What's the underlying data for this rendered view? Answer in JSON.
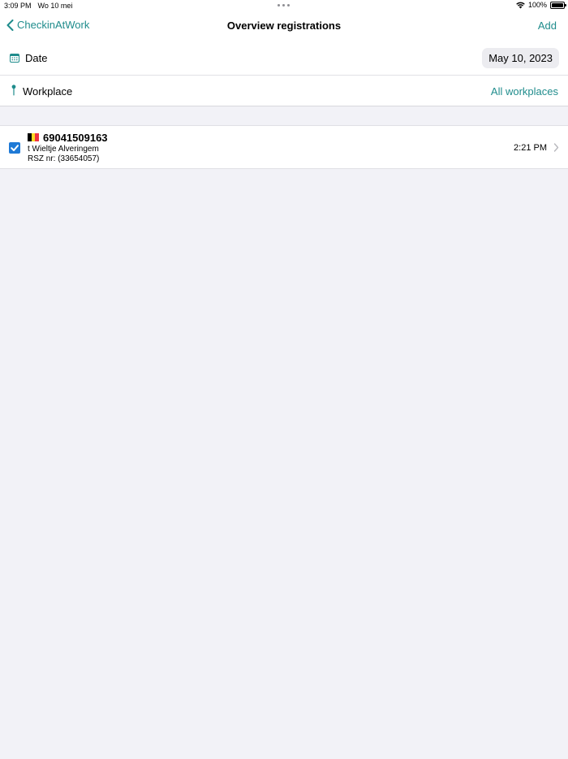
{
  "status_bar": {
    "time": "3:09 PM",
    "date": "Wo 10 mei",
    "battery": "100%",
    "icons": [
      "wifi-icon",
      "battery-icon"
    ]
  },
  "nav": {
    "back_label": "CheckinAtWork",
    "title": "Overview registrations",
    "add_label": "Add"
  },
  "filters": {
    "date_label": "Date",
    "date_value": "May 10, 2023",
    "workplace_label": "Workplace",
    "workplace_value": "All workplaces"
  },
  "registrations": [
    {
      "number": "69041509163",
      "place": "t Wieltje Alveringem",
      "rsz": "RSZ nr: (33654057)",
      "time": "2:21 PM",
      "checked": true,
      "flag": "belgium-flag-icon"
    }
  ],
  "colors": {
    "accent": "#1f8c8c",
    "checkbox": "#1f7ad6",
    "background": "#f2f2f7"
  }
}
